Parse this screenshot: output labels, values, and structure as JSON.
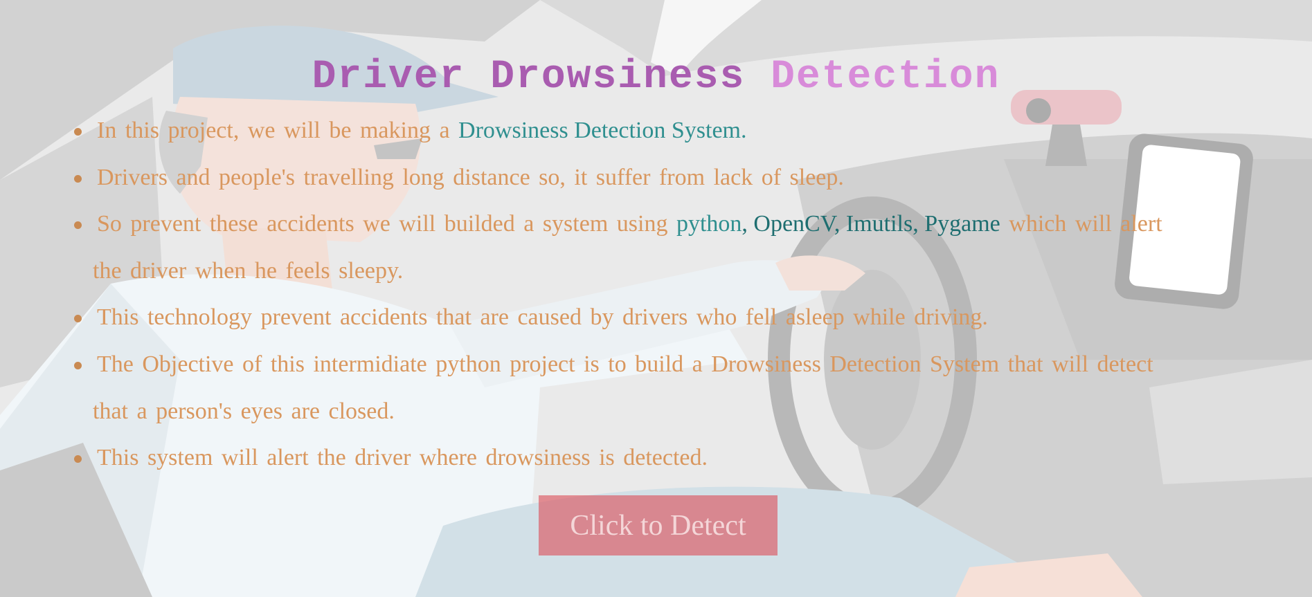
{
  "page": {
    "title_part1": "Driver Drowsiness",
    "title_part2": "Detection",
    "title_colors": [
      "#a95cb0",
      "#d88bd9"
    ],
    "text_color": "#d9975e",
    "highlight_colors": [
      "#2f8f8f",
      "#1e6e70"
    ]
  },
  "bullets": [
    {
      "text_before": "In this project, we will be making a ",
      "highlight": "Drowsiness Detection System."
    },
    {
      "text": "Drivers and people's travelling long distance so, it suffer from lack of sleep."
    },
    {
      "text_before": "So prevent these accidents we will builded a system using ",
      "h1": "python",
      "sep1": ", ",
      "h2": "OpenCV, Imutils, Pygame",
      "text_after_line1": " which will alert",
      "text_line2": "the driver when he feels sleepy."
    },
    {
      "text": "This technology prevent accidents that are caused by drivers who fell asleep while driving."
    },
    {
      "text_line1": "The Objective of this intermidiate python project is to build a Drowsiness Detection System that will detect",
      "text_line2": "that a person's eyes are closed."
    },
    {
      "text": "This system will alert the driver where drowsiness is detected."
    }
  ],
  "button": {
    "label": "Click to Detect",
    "color": "#dc505a"
  }
}
